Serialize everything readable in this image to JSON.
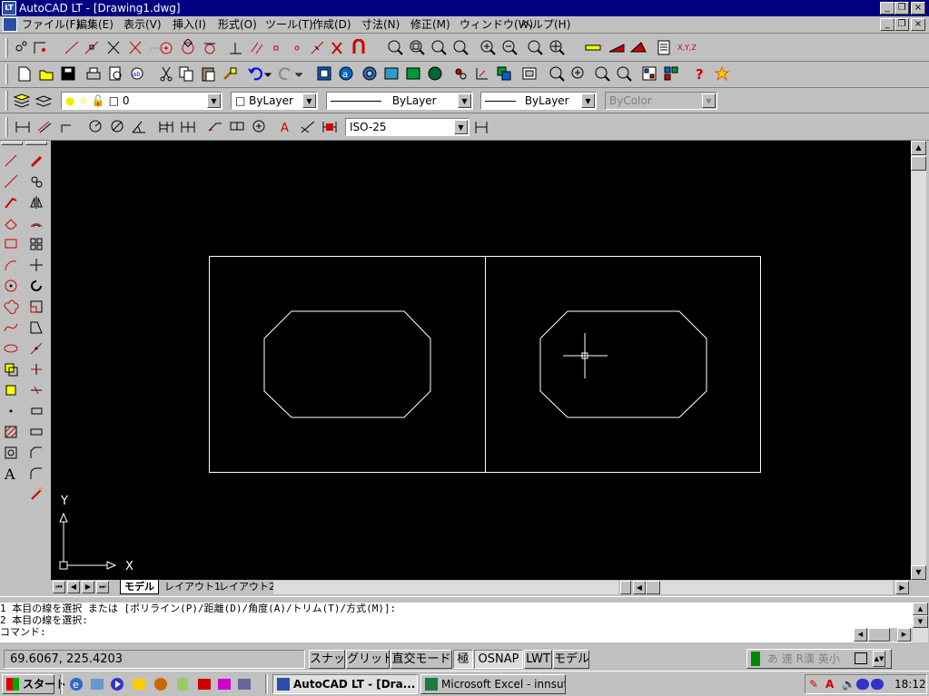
{
  "window": {
    "title": "AutoCAD LT - [Drawing1.dwg]",
    "app_icon_text": "LT",
    "minimize": "_",
    "restore": "❐",
    "close": "×"
  },
  "menu": {
    "items": [
      "ファイル(F)",
      "編集(E)",
      "表示(V)",
      "挿入(I)",
      "形式(O)",
      "ツール(T)",
      "作成(D)",
      "寸法(N)",
      "修正(M)",
      "ウィンドウ(W)",
      "ヘルプ(H)"
    ]
  },
  "properties": {
    "layer_value": "0",
    "color_value": "ByLayer",
    "linetype_value": "ByLayer",
    "lineweight_value": "ByLayer",
    "plotstyle_value": "ByColor"
  },
  "dimension": {
    "style_value": "ISO-25"
  },
  "tabs": {
    "items": [
      "モデル",
      "レイアウト1",
      "レイアウト2"
    ],
    "active": "モデル"
  },
  "ucs": {
    "x_label": "X",
    "y_label": "Y"
  },
  "command": {
    "lines": [
      "1 本目の線を選択 または [ポリライン(P)/距離(D)/角度(A)/トリム(T)/方式(M)]:",
      "2 本目の線を選択:",
      "コマンド:"
    ]
  },
  "status": {
    "coordinates": "69.6067, 225.4203",
    "buttons": [
      "スナップ",
      "グリッド",
      "直交モード",
      "極",
      "OSNAP",
      "LWT",
      "モデル"
    ]
  },
  "taskbar": {
    "start_label": "スタート",
    "tasks": [
      {
        "label": "AutoCAD LT - [Dra...",
        "active": true
      },
      {
        "label": "Microsoft Excel - innsut...",
        "active": false
      }
    ],
    "ime_text": "あ 連 R漢 英小",
    "clock": "18:12"
  },
  "colors": {
    "titlebar": "#000080",
    "canvas": "#000000",
    "chrome": "#c0c0c0",
    "lines": "#ffffff"
  }
}
